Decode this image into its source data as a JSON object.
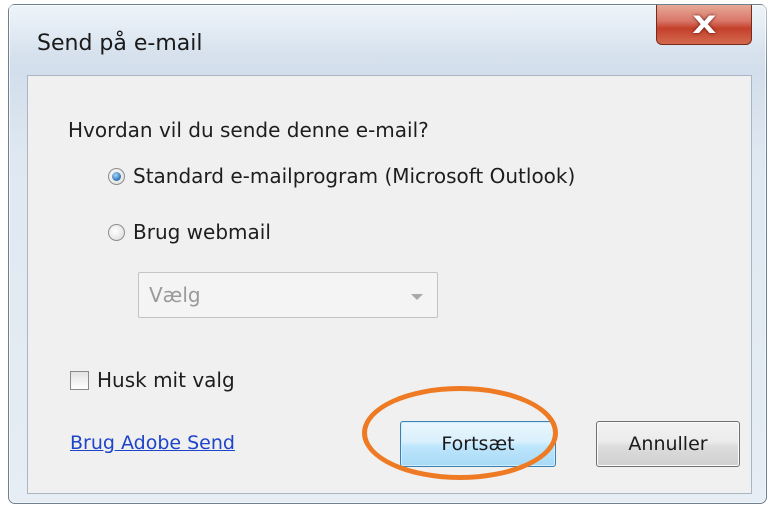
{
  "window": {
    "title": "Send på e-mail",
    "close_glyph": "X"
  },
  "dialog": {
    "question": "Hvordan vil du sende denne e-mail?",
    "options": [
      {
        "label": "Standard e-mailprogram (Microsoft Outlook)",
        "selected": true
      },
      {
        "label": "Brug webmail",
        "selected": false
      }
    ],
    "webmail_select": {
      "value": "Vælg",
      "enabled": false
    },
    "remember": {
      "label": "Husk mit valg",
      "checked": false
    },
    "adobe_link": "Brug Adobe Send",
    "buttons": {
      "continue": "Fortsæt",
      "cancel": "Annuller"
    }
  },
  "annotation": {
    "highlight_color": "#ee7a24",
    "highlight_target": "continue-button"
  },
  "colors": {
    "link": "#1d44c9",
    "close_button": "#c4402b",
    "primary_button_border": "#3c7fb1"
  }
}
